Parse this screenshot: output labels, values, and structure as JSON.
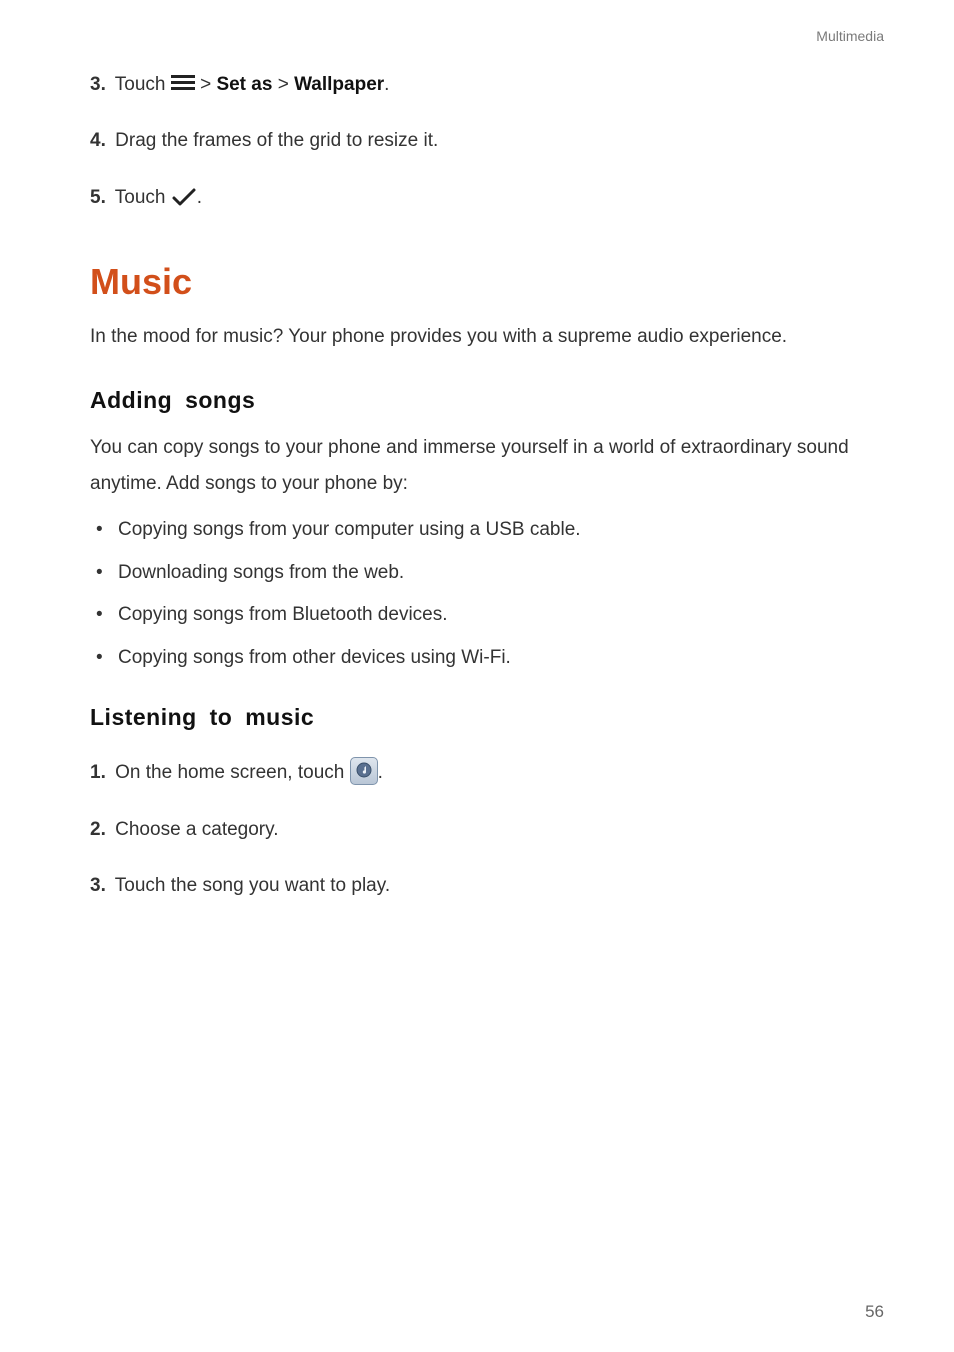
{
  "header": {
    "section": "Multimedia"
  },
  "page_number": "56",
  "top_steps": {
    "s3": {
      "num": "3.",
      "prefix": "Touch ",
      "mid1": " > ",
      "bold1": "Set as",
      "mid2": " > ",
      "bold2": "Wallpaper",
      "tail": "."
    },
    "s4": {
      "num": "4.",
      "text": "Drag the frames of the grid to resize it."
    },
    "s5": {
      "num": "5.",
      "text": "Touch ",
      "tail": "."
    }
  },
  "section": {
    "title": "Music",
    "intro": "In the mood for music? Your phone provides you with a supreme audio experience."
  },
  "adding": {
    "title": "Adding  songs",
    "intro": "You can copy songs to your phone and immerse yourself in a world of extraordinary sound anytime. Add songs to your phone by:",
    "bullets": [
      "Copying songs from your computer using a USB cable.",
      "Downloading songs from the web.",
      "Copying songs from Bluetooth devices.",
      "Copying songs from other devices using Wi-Fi."
    ]
  },
  "listening": {
    "title": "Listening  to  music",
    "s1": {
      "num": "1.",
      "text": "On the home screen, touch ",
      "tail": "."
    },
    "s2": {
      "num": "2.",
      "text": "Choose a category."
    },
    "s3": {
      "num": "3.",
      "text": "Touch the song you want to play."
    }
  }
}
